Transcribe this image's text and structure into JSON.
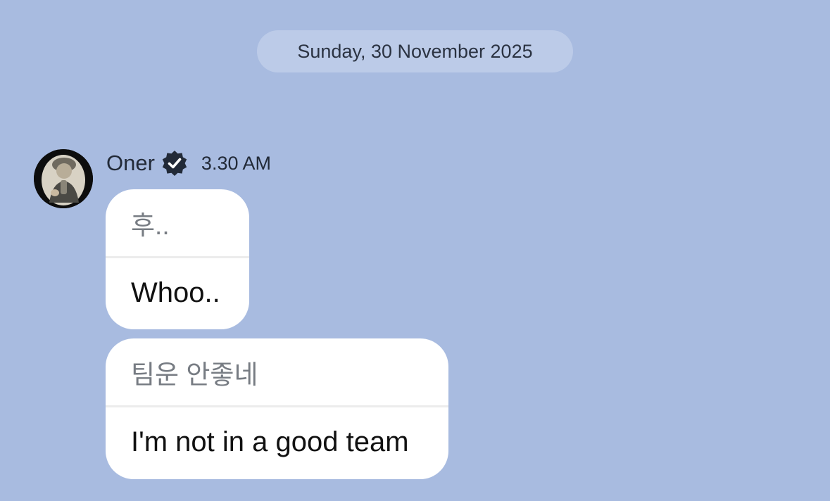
{
  "date_separator": "Sunday, 30 November 2025",
  "message_group": {
    "sender": "Oner",
    "verified_icon": "verified-badge-icon",
    "time": "3.30 AM",
    "messages": [
      {
        "original": "후..",
        "translation": "Whoo.."
      },
      {
        "original": "팀운 안좋네",
        "translation": "I'm not in a good team"
      }
    ]
  },
  "colors": {
    "background": "#a8bbe0",
    "date_pill": "#bccbe8",
    "bubble": "#ffffff",
    "text_dark": "#222a38",
    "text_original": "#777c83"
  }
}
